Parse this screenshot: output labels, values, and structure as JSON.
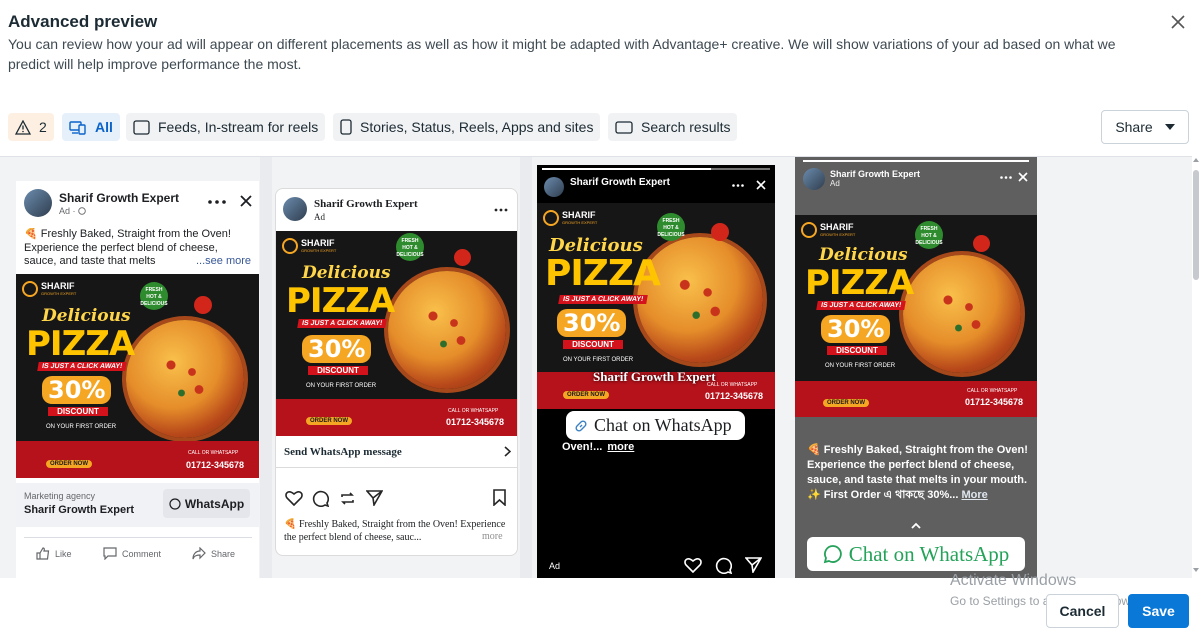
{
  "header": {
    "title": "Advanced preview",
    "description": "You can review how your ad will appear on different placements as well as how it might be adapted with Advantage+ creative. We will show variations of your ad based on what we predict will help improve performance the most."
  },
  "toolbar": {
    "warning_count": "2",
    "all_label": "All",
    "feeds_label": "Feeds, In-stream for reels",
    "stories_label": "Stories, Status, Reels, Apps and sites",
    "search_label": "Search results",
    "share_label": "Share"
  },
  "poster": {
    "brand": "SHARIF",
    "brand_sub": "GROWTH EXPERT",
    "badge": "FRESH HOT & DELICIOUS",
    "delicious": "Delicious",
    "pizza": "PIZZA",
    "click": "IS JUST A CLICK AWAY!",
    "percent": "30%",
    "discount": "DISCOUNT",
    "first_order": "ON YOUR FIRST ORDER",
    "order_now": "ORDER NOW",
    "call": "CALL OR WHATSAPP",
    "phone": "01712-345678"
  },
  "fb": {
    "page_name": "Sharif Growth Expert",
    "ad_label": "Ad · ",
    "caption": "🍕 Freshly Baked, Straight from the Oven! Experience the perfect blend of cheese, sauce, and taste that melts",
    "see_more": "...see more",
    "agency_label": "Marketing agency",
    "agency_name": "Sharif Growth Expert",
    "whatsapp_btn": "WhatsApp",
    "like": "Like",
    "comment": "Comment",
    "share": "Share"
  },
  "ig": {
    "page_name": "Sharif Growth Expert",
    "ad_label": "Ad",
    "cta": "Send WhatsApp message",
    "caption": "🍕 Freshly Baked, Straight from the Oven! Experience the perfect blend of cheese, sauc...",
    "more": "more"
  },
  "ig_story": {
    "page_name": "Sharif Growth Expert",
    "overlay_name": "Sharif Growth Expert",
    "cta": "Chat on WhatsApp",
    "caption": "Oven!...",
    "more": "more",
    "ad_label": "Ad"
  },
  "fb_story": {
    "page_name": "Sharif Growth Expert",
    "ad_label": "Ad",
    "caption": "🍕 Freshly Baked, Straight from the Oven! Experience the perfect blend of cheese, sauce, and taste that melts in your mouth. ✨ First Order এ থাকছে 30%...",
    "more": "More",
    "cta": "Chat on WhatsApp"
  },
  "watermark": {
    "line1": "Activate Windows",
    "line2": "Go to Settings to activate Windows."
  },
  "footer": {
    "cancel": "Cancel",
    "save": "Save"
  },
  "colors": {
    "accent": "#0a78d7",
    "whatsapp": "#25d366",
    "poster_red": "#b5121b",
    "poster_yellow": "#ffc400"
  }
}
